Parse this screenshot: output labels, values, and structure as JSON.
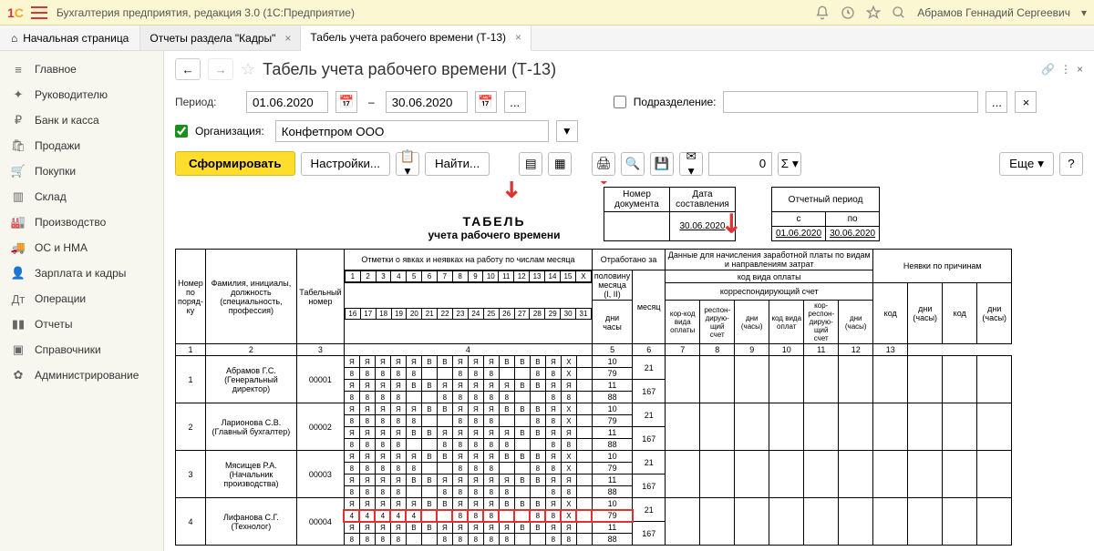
{
  "titlebar": {
    "app_title": "Бухгалтерия предприятия, редакция 3.0   (1С:Предприятие)",
    "user_name": "Абрамов Геннадий Сергеевич"
  },
  "tabs": {
    "home": "Начальная страница",
    "t1": "Отчеты раздела \"Кадры\"",
    "t2": "Табель учета рабочего времени (Т-13)"
  },
  "sidebar": {
    "items": [
      {
        "icon": "≡",
        "label": "Главное"
      },
      {
        "icon": "✦",
        "label": "Руководителю"
      },
      {
        "icon": "₽",
        "label": "Банк и касса"
      },
      {
        "icon": "🛍",
        "label": "Продажи"
      },
      {
        "icon": "🛒",
        "label": "Покупки"
      },
      {
        "icon": "▥",
        "label": "Склад"
      },
      {
        "icon": "🏭",
        "label": "Производство"
      },
      {
        "icon": "🚚",
        "label": "ОС и НМА"
      },
      {
        "icon": "👤",
        "label": "Зарплата и кадры"
      },
      {
        "icon": "Дт",
        "label": "Операции"
      },
      {
        "icon": "▮▮",
        "label": "Отчеты"
      },
      {
        "icon": "▣",
        "label": "Справочники"
      },
      {
        "icon": "✿",
        "label": "Администрирование"
      }
    ]
  },
  "header": {
    "title": "Табель учета рабочего времени (Т-13)"
  },
  "filters": {
    "period_label": "Период:",
    "date_from": "01.06.2020",
    "date_to": "30.06.2020",
    "ellipsis": "...",
    "subdivision_label": "Подразделение:",
    "subdivision_value": "",
    "org_label": "Организация:",
    "org_checked": "✓",
    "org_value": "Конфетпром ООО"
  },
  "toolbar": {
    "generate": "Сформировать",
    "settings": "Настройки...",
    "find": "Найти...",
    "num_value": "0",
    "sigma": "Σ",
    "more": "Еще",
    "help": "?"
  },
  "doc_header": {
    "doc_num_label": "Номер документа",
    "doc_date_label": "Дата составления",
    "doc_date_value": "30.06.2020",
    "period_label": "Отчетный период",
    "from_label": "с",
    "to_label": "по",
    "from_value": "01.06.2020",
    "to_value": "30.06.2020",
    "title_word": "ТАБЕЛЬ",
    "subtitle": "учета  рабочего времени"
  },
  "table_headers": {
    "rownum": "Номер по поряд-ку",
    "fio": "Фамилия, инициалы, должность (специальность, профессия)",
    "tabnum": "Табельный номер",
    "marks": "Отметки о явках и неявках на работу по числам месяца",
    "worked": "Отработано за",
    "half": "половину месяца (I, II)",
    "month": "месяц",
    "days": "дни",
    "hours": "часы",
    "payroll": "Данные для начисления заработной платы по видам и направлениям затрат",
    "paycode": "код вида оплаты",
    "corr": "корреспондирующий счет",
    "absences": "Неявки по причинам",
    "code": "код",
    "absent_days": "дни (часы)"
  },
  "col_nums": [
    "1",
    "2",
    "3",
    "4",
    "5",
    "6",
    "7",
    "8",
    "9",
    "10",
    "11",
    "12",
    "13"
  ],
  "days_row1": [
    "1",
    "2",
    "3",
    "4",
    "5",
    "6",
    "7",
    "8",
    "9",
    "10",
    "11",
    "12",
    "13",
    "14",
    "15",
    "X"
  ],
  "days_row2": [
    "16",
    "17",
    "18",
    "19",
    "20",
    "21",
    "22",
    "23",
    "24",
    "25",
    "26",
    "27",
    "28",
    "29",
    "30",
    "31"
  ],
  "pay_cols": [
    "кор-код вида оплаты",
    "респон-дирую-щий счет",
    "дни (часы)",
    "код вида оплат",
    "кор-респон-дирую-щий счет",
    "дни (часы)"
  ],
  "employees": [
    {
      "num": "1",
      "fio": "Абрамов Г.С. (Генеральный директор)",
      "tabnum": "00001",
      "r1": [
        "Я",
        "Я",
        "Я",
        "Я",
        "Я",
        "В",
        "В",
        "Я",
        "Я",
        "Я",
        "В",
        "В",
        "В",
        "Я",
        "Х"
      ],
      "r1h": [
        "8",
        "8",
        "8",
        "8",
        "8",
        "",
        "",
        "8",
        "8",
        "8",
        "",
        "",
        "8",
        "8",
        "Х"
      ],
      "r2": [
        "Я",
        "Я",
        "Я",
        "Я",
        "В",
        "В",
        "Я",
        "Я",
        "Я",
        "Я",
        "Я",
        "В",
        "В",
        "Я",
        "Я"
      ],
      "r2h": [
        "8",
        "8",
        "8",
        "8",
        "",
        "",
        "8",
        "8",
        "8",
        "8",
        "8",
        "",
        "",
        "8",
        "8"
      ],
      "half1": "10",
      "half1h": "79",
      "half2": "11",
      "half2h": "88",
      "mon_d": "21",
      "mon_h": "167"
    },
    {
      "num": "2",
      "fio": "Ларионова С.В. (Главный бухгалтер)",
      "tabnum": "00002",
      "r1": [
        "Я",
        "Я",
        "Я",
        "Я",
        "Я",
        "В",
        "В",
        "Я",
        "Я",
        "Я",
        "В",
        "В",
        "В",
        "Я",
        "Х"
      ],
      "r1h": [
        "8",
        "8",
        "8",
        "8",
        "8",
        "",
        "",
        "8",
        "8",
        "8",
        "",
        "",
        "8",
        "8",
        "Х"
      ],
      "r2": [
        "Я",
        "Я",
        "Я",
        "Я",
        "В",
        "В",
        "Я",
        "Я",
        "Я",
        "Я",
        "Я",
        "В",
        "В",
        "Я",
        "Я"
      ],
      "r2h": [
        "8",
        "8",
        "8",
        "8",
        "",
        "",
        "8",
        "8",
        "8",
        "8",
        "8",
        "",
        "",
        "8",
        "8"
      ],
      "half1": "10",
      "half1h": "79",
      "half2": "11",
      "half2h": "88",
      "mon_d": "21",
      "mon_h": "167"
    },
    {
      "num": "3",
      "fio": "Мясищев Р.А. (Начальник производства)",
      "tabnum": "00003",
      "r1": [
        "Я",
        "Я",
        "Я",
        "Я",
        "Я",
        "В",
        "В",
        "Я",
        "Я",
        "Я",
        "В",
        "В",
        "В",
        "Я",
        "Х"
      ],
      "r1h": [
        "8",
        "8",
        "8",
        "8",
        "8",
        "",
        "",
        "8",
        "8",
        "8",
        "",
        "",
        "8",
        "8",
        "Х"
      ],
      "r2": [
        "Я",
        "Я",
        "Я",
        "Я",
        "В",
        "В",
        "Я",
        "Я",
        "Я",
        "Я",
        "Я",
        "В",
        "В",
        "Я",
        "Я"
      ],
      "r2h": [
        "8",
        "8",
        "8",
        "8",
        "",
        "",
        "8",
        "8",
        "8",
        "8",
        "8",
        "",
        "",
        "8",
        "8"
      ],
      "half1": "10",
      "half1h": "79",
      "half2": "11",
      "half2h": "88",
      "mon_d": "21",
      "mon_h": "167"
    },
    {
      "num": "4",
      "fio": "Лифанова С.Г. (Технолог)",
      "tabnum": "00004",
      "r1": [
        "Я",
        "Я",
        "Я",
        "Я",
        "Я",
        "В",
        "В",
        "Я",
        "Я",
        "Я",
        "В",
        "В",
        "В",
        "Я",
        "Х"
      ],
      "r1h": [
        "4",
        "4",
        "4",
        "4",
        "4",
        "",
        "",
        "8",
        "8",
        "8",
        "",
        "",
        "8",
        "8",
        "Х"
      ],
      "r2": [
        "Я",
        "Я",
        "Я",
        "Я",
        "В",
        "В",
        "Я",
        "Я",
        "Я",
        "Я",
        "Я",
        "В",
        "В",
        "Я",
        "Я"
      ],
      "r2h": [
        "8",
        "8",
        "8",
        "8",
        "",
        "",
        "8",
        "8",
        "8",
        "8",
        "8",
        "",
        "",
        "8",
        "8"
      ],
      "half1": "10",
      "half1h": "79",
      "half2": "11",
      "half2h": "88",
      "mon_d": "21",
      "mon_h": "167"
    }
  ]
}
